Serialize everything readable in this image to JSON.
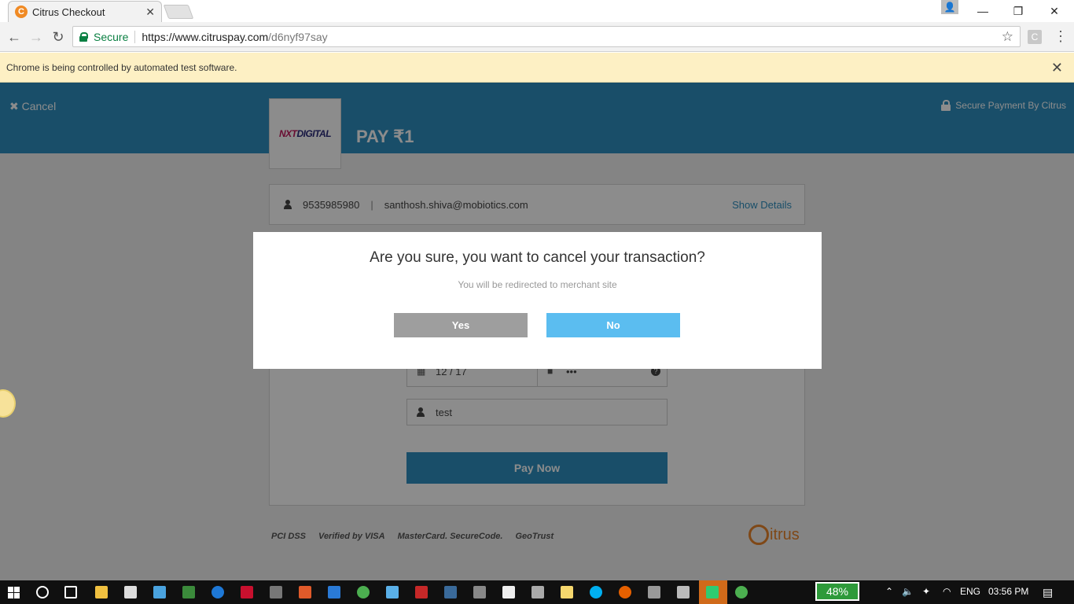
{
  "browser": {
    "tab_title": "Citrus Checkout",
    "tab_favicon_letter": "C",
    "security_label": "Secure",
    "url_host": "https://www.citruspay.com",
    "url_path": "/d6nyf97say",
    "extension_letter": "C",
    "infobar_text": "Chrome is being controlled by automated test software."
  },
  "header": {
    "cancel_label": "✖ Cancel",
    "secure_label": "Secure Payment By Citrus",
    "merchant_logo": "DIGITAL",
    "merchant_logo_mark": "NXT",
    "pay_label": "PAY ₹1"
  },
  "user": {
    "phone": "9535985980",
    "separator": "|",
    "email": "santhosh.shiva@mobiotics.com",
    "show_details": "Show Details"
  },
  "card": {
    "expiry": "12 / 17",
    "cvv_mask": "•••",
    "help": "?",
    "name": "test",
    "pay_now": "Pay Now"
  },
  "footer": {
    "logos": [
      "PCI DSS",
      "Verified by VISA",
      "MasterCard. SecureCode.",
      "GeoTrust"
    ],
    "brand": "itrus"
  },
  "modal": {
    "title": "Are you sure, you want to cancel your transaction?",
    "subtitle": "You will be redirected to merchant site",
    "yes_label": "Yes",
    "no_label": "No"
  },
  "taskbar": {
    "battery": "48%",
    "language": "ENG",
    "time": "03:56 PM"
  },
  "colors": {
    "header": "#2e8fbf",
    "no_button": "#5bbdf0",
    "yes_button": "#9e9e9e",
    "infobar": "#fdf0c4"
  }
}
